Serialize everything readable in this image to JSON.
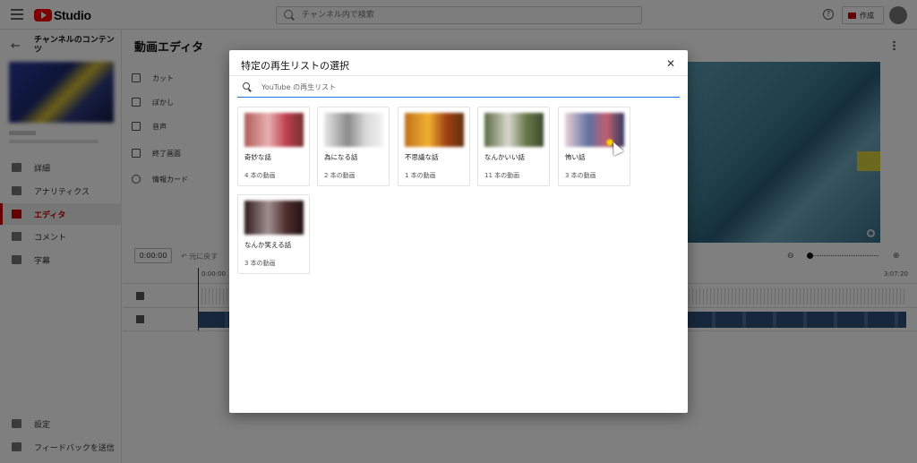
{
  "app": {
    "logo_text": "Studio"
  },
  "search": {
    "placeholder": "チャンネル内で検索"
  },
  "header": {
    "help_icon": "?",
    "create_label": "作成"
  },
  "sidebar": {
    "channel_title": "チャンネルのコンテンツ",
    "items": [
      {
        "label": "詳細",
        "icon": "pencil-icon"
      },
      {
        "label": "アナリティクス",
        "icon": "analytics-icon"
      },
      {
        "label": "エディタ",
        "icon": "editor-icon",
        "active": true
      },
      {
        "label": "コメント",
        "icon": "comment-icon"
      },
      {
        "label": "字幕",
        "icon": "subtitles-icon"
      }
    ],
    "footer": [
      {
        "label": "設定",
        "icon": "gear-icon"
      },
      {
        "label": "フィードバックを送信",
        "icon": "feedback-icon"
      }
    ]
  },
  "editor": {
    "title": "動画エディタ",
    "tools": [
      {
        "label": "カット",
        "icon": "scissors-icon"
      },
      {
        "label": "ぼかし",
        "icon": "blur-icon"
      },
      {
        "label": "音声",
        "icon": "music-icon"
      },
      {
        "label": "終了画面",
        "icon": "end-screen-icon"
      },
      {
        "label": "情報カード",
        "icon": "info-icon"
      }
    ],
    "time_value": "0:00:00",
    "undo_label": "元に戻す",
    "ruler_start": "0:00:00",
    "ruler_end": "3:07:20"
  },
  "dialog": {
    "title": "特定の再生リストの選択",
    "close_label": "✕",
    "search_placeholder": "YouTube の再生リスト",
    "playlists": [
      {
        "name": "奇妙な話",
        "count": "4 本の動画"
      },
      {
        "name": "為になる話",
        "count": "2 本の動画"
      },
      {
        "name": "不思議な話",
        "count": "1 本の動画"
      },
      {
        "name": "なんかいい話",
        "count": "11 本の動画"
      },
      {
        "name": "怖い話",
        "count": "3 本の動画"
      },
      {
        "name": "なんか笑える話",
        "count": "3 本の動画"
      }
    ]
  },
  "colors": {
    "accent": "#cc0000",
    "focus_blue": "#1a73e8",
    "overlay": "rgba(0,0,0,0.5)"
  }
}
